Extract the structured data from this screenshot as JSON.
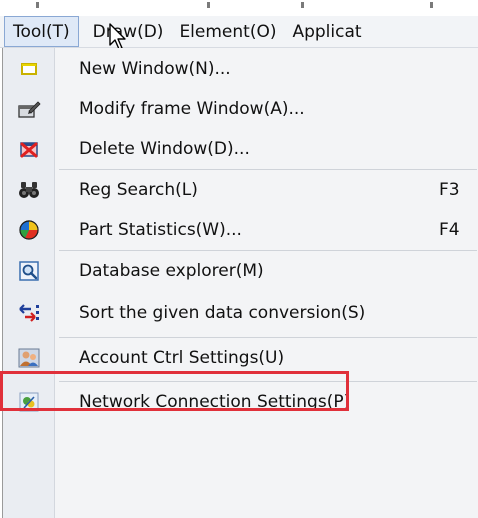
{
  "menubar": {
    "items": [
      {
        "label": "Tool(T)"
      },
      {
        "label": "Draw(D)"
      },
      {
        "label": "Element(O)"
      },
      {
        "label": "Applicat"
      }
    ]
  },
  "menu": {
    "items": [
      {
        "label": "New Window(N)...",
        "shortcut": "",
        "icon": "new-window-icon"
      },
      {
        "label": "Modify frame Window(A)...",
        "shortcut": "",
        "icon": "modify-window-icon"
      },
      {
        "label": "Delete Window(D)...",
        "shortcut": "",
        "icon": "delete-window-icon"
      },
      {
        "label": "Reg Search(L)",
        "shortcut": "F3",
        "icon": "binoculars-icon"
      },
      {
        "label": "Part Statistics(W)...",
        "shortcut": "F4",
        "icon": "pie-chart-icon"
      },
      {
        "label": "Database explorer(M)",
        "shortcut": "",
        "icon": "database-search-icon"
      },
      {
        "label": "Sort the given data conversion(S)",
        "shortcut": "",
        "icon": "sort-arrows-icon"
      },
      {
        "label": "Account Ctrl Settings(U)",
        "shortcut": "",
        "icon": "account-users-icon"
      },
      {
        "label": "Network Connection Settings(P)",
        "shortcut": "",
        "icon": "network-connection-icon"
      }
    ]
  },
  "colors": {
    "highlight_border": "#e0303a",
    "menu_background": "#f3f4f6"
  }
}
